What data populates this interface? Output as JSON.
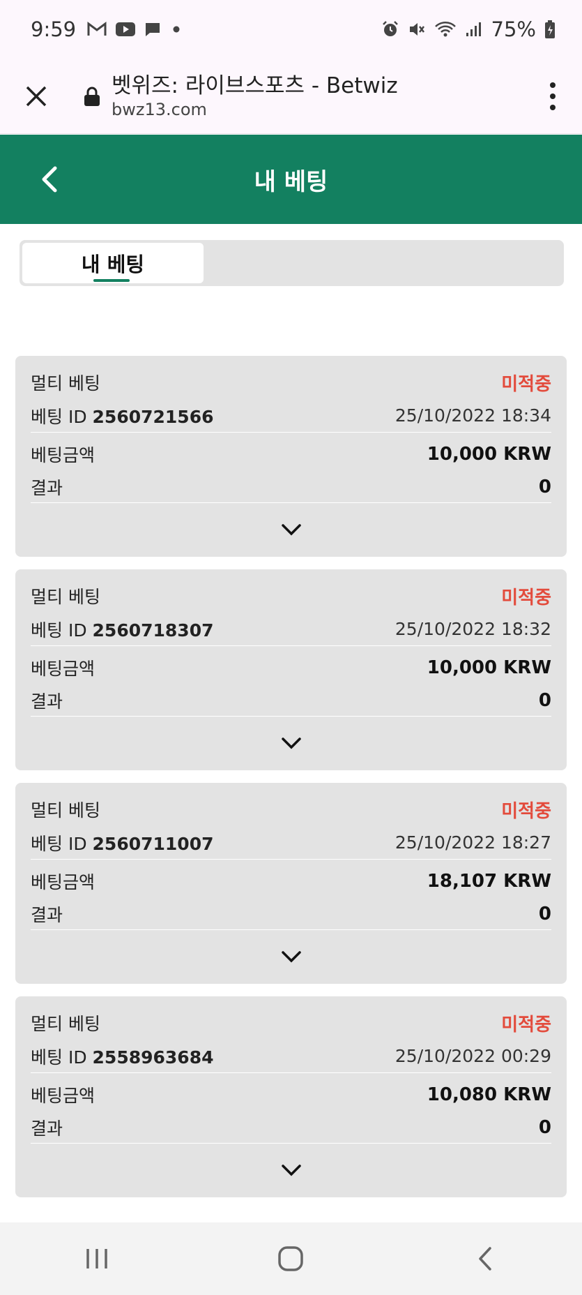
{
  "status_bar": {
    "time": "9:59",
    "battery": "75%"
  },
  "browser": {
    "title": "벳위즈: 라이브스포츠 - Betwiz",
    "domain": "bwz13.com"
  },
  "header": {
    "title": "내 베팅"
  },
  "tabs": [
    {
      "label": "내 베팅",
      "active": true
    }
  ],
  "labels": {
    "bet_id_prefix": "베팅 ID",
    "amount": "베팅금액",
    "result": "결과"
  },
  "bets": [
    {
      "type": "멀티 베팅",
      "status": "미적중",
      "id": "2560721566",
      "datetime": "25/10/2022 18:34",
      "amount": "10,000 KRW",
      "result": "0"
    },
    {
      "type": "멀티 베팅",
      "status": "미적중",
      "id": "2560718307",
      "datetime": "25/10/2022 18:32",
      "amount": "10,000 KRW",
      "result": "0"
    },
    {
      "type": "멀티 베팅",
      "status": "미적중",
      "id": "2560711007",
      "datetime": "25/10/2022 18:27",
      "amount": "18,107 KRW",
      "result": "0"
    },
    {
      "type": "멀티 베팅",
      "status": "미적중",
      "id": "2558963684",
      "datetime": "25/10/2022 00:29",
      "amount": "10,080 KRW",
      "result": "0"
    }
  ],
  "colors": {
    "brand_green": "#138060",
    "status_red": "#e34b3c",
    "card_bg": "#e3e3e3"
  }
}
